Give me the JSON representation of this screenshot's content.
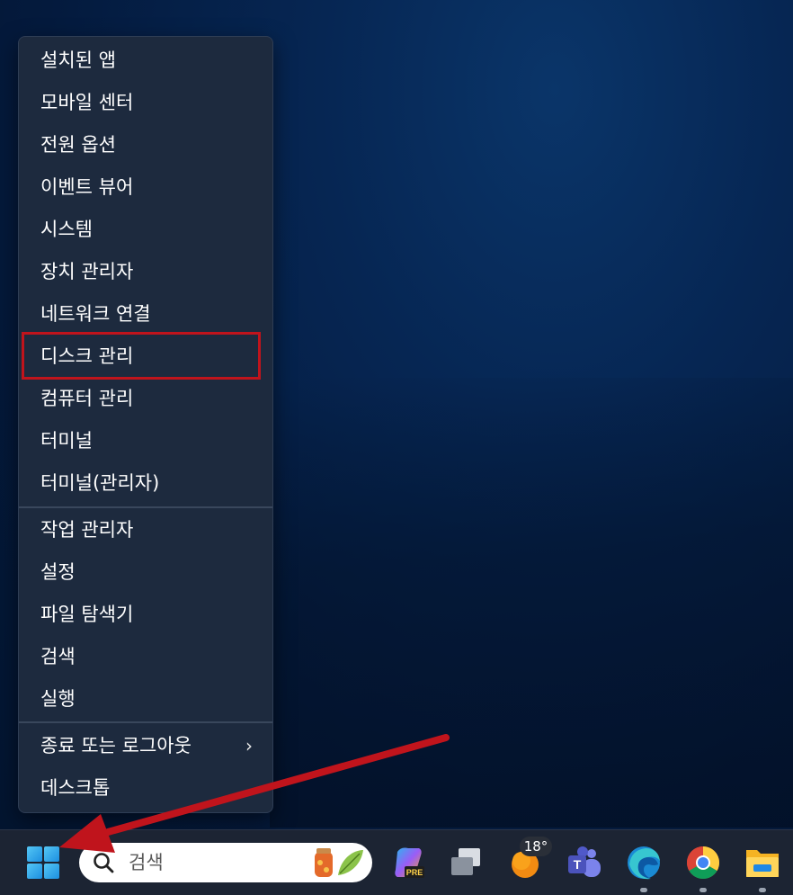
{
  "context_menu": {
    "groups": [
      [
        "설치된 앱",
        "모바일 센터",
        "전원 옵션",
        "이벤트 뷰어",
        "시스템",
        "장치 관리자",
        "네트워크 연결",
        "디스크 관리",
        "컴퓨터 관리",
        "터미널",
        "터미널(관리자)"
      ],
      [
        "작업 관리자",
        "설정",
        "파일 탐색기",
        "검색",
        "실행"
      ],
      [
        "종료 또는 로그아웃",
        "데스크톱"
      ]
    ],
    "highlighted_item": "디스크 관리",
    "submenu_item": "종료 또는 로그아웃"
  },
  "taskbar": {
    "search_placeholder": "검색",
    "weather_temp": "18°",
    "copilot_badge": "PRE",
    "teams_letter": "T",
    "apps": [
      "start",
      "search",
      "copilot",
      "task-view",
      "weather",
      "teams",
      "edge",
      "chrome",
      "file-explorer"
    ]
  },
  "annotation": {
    "highlight_color": "#c0141c",
    "arrow_color": "#c0141c"
  }
}
